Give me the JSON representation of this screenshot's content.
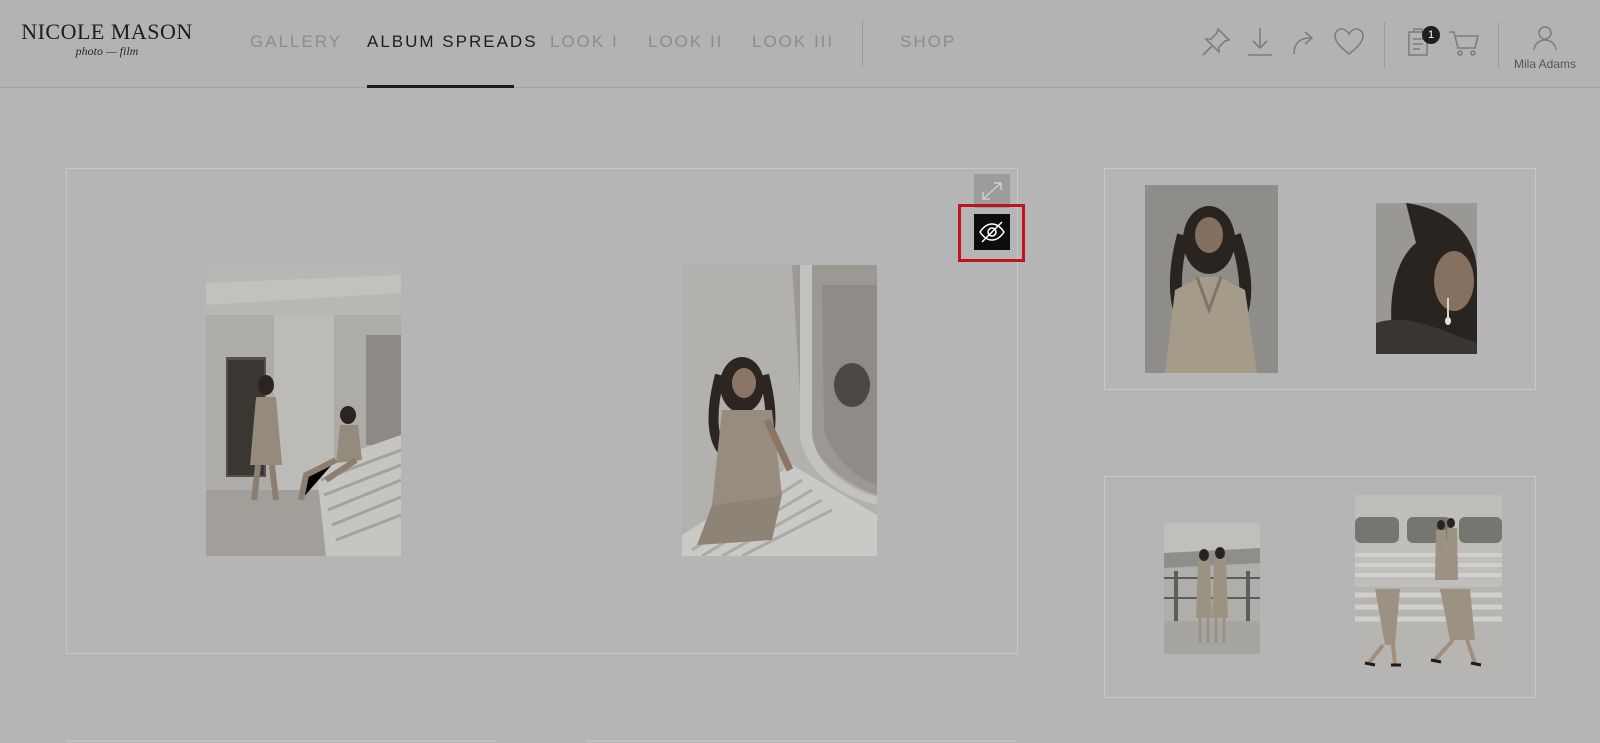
{
  "logo": {
    "name": "NICOLE MASON",
    "tagline": "photo — film"
  },
  "nav": {
    "items": [
      {
        "label": "GALLERY",
        "active": false
      },
      {
        "label": "ALBUM SPREADS",
        "active": true
      },
      {
        "label": "LOOK I",
        "active": false
      },
      {
        "label": "LOOK II",
        "active": false
      },
      {
        "label": "LOOK III",
        "active": false
      },
      {
        "label": "SHOP",
        "active": false
      }
    ]
  },
  "toolbar": {
    "icons": [
      "pin-icon",
      "download-icon",
      "share-icon",
      "heart-icon",
      "clipboard-icon",
      "cart-icon"
    ],
    "clipboard_badge": "1"
  },
  "user": {
    "name": "Mila Adams",
    "icon": "user-icon"
  },
  "spreads": {
    "main": {
      "photos": [
        "ferry-bench-two-women",
        "woman-leaning-window"
      ]
    },
    "thumb1": {
      "photos": [
        "woman-curly-hair-coat",
        "woman-earring-closeup"
      ]
    },
    "thumb2": {
      "photos": [
        "two-women-ferry-deck",
        "ferry-windows-walking-collage"
      ]
    }
  },
  "controls": {
    "expand_icon": "expand-icon",
    "hide_icon": "eye-slash-icon"
  },
  "colors": {
    "highlight": "#c1121f",
    "background": "#b5b5b5",
    "active_text": "#1e1e1e"
  }
}
